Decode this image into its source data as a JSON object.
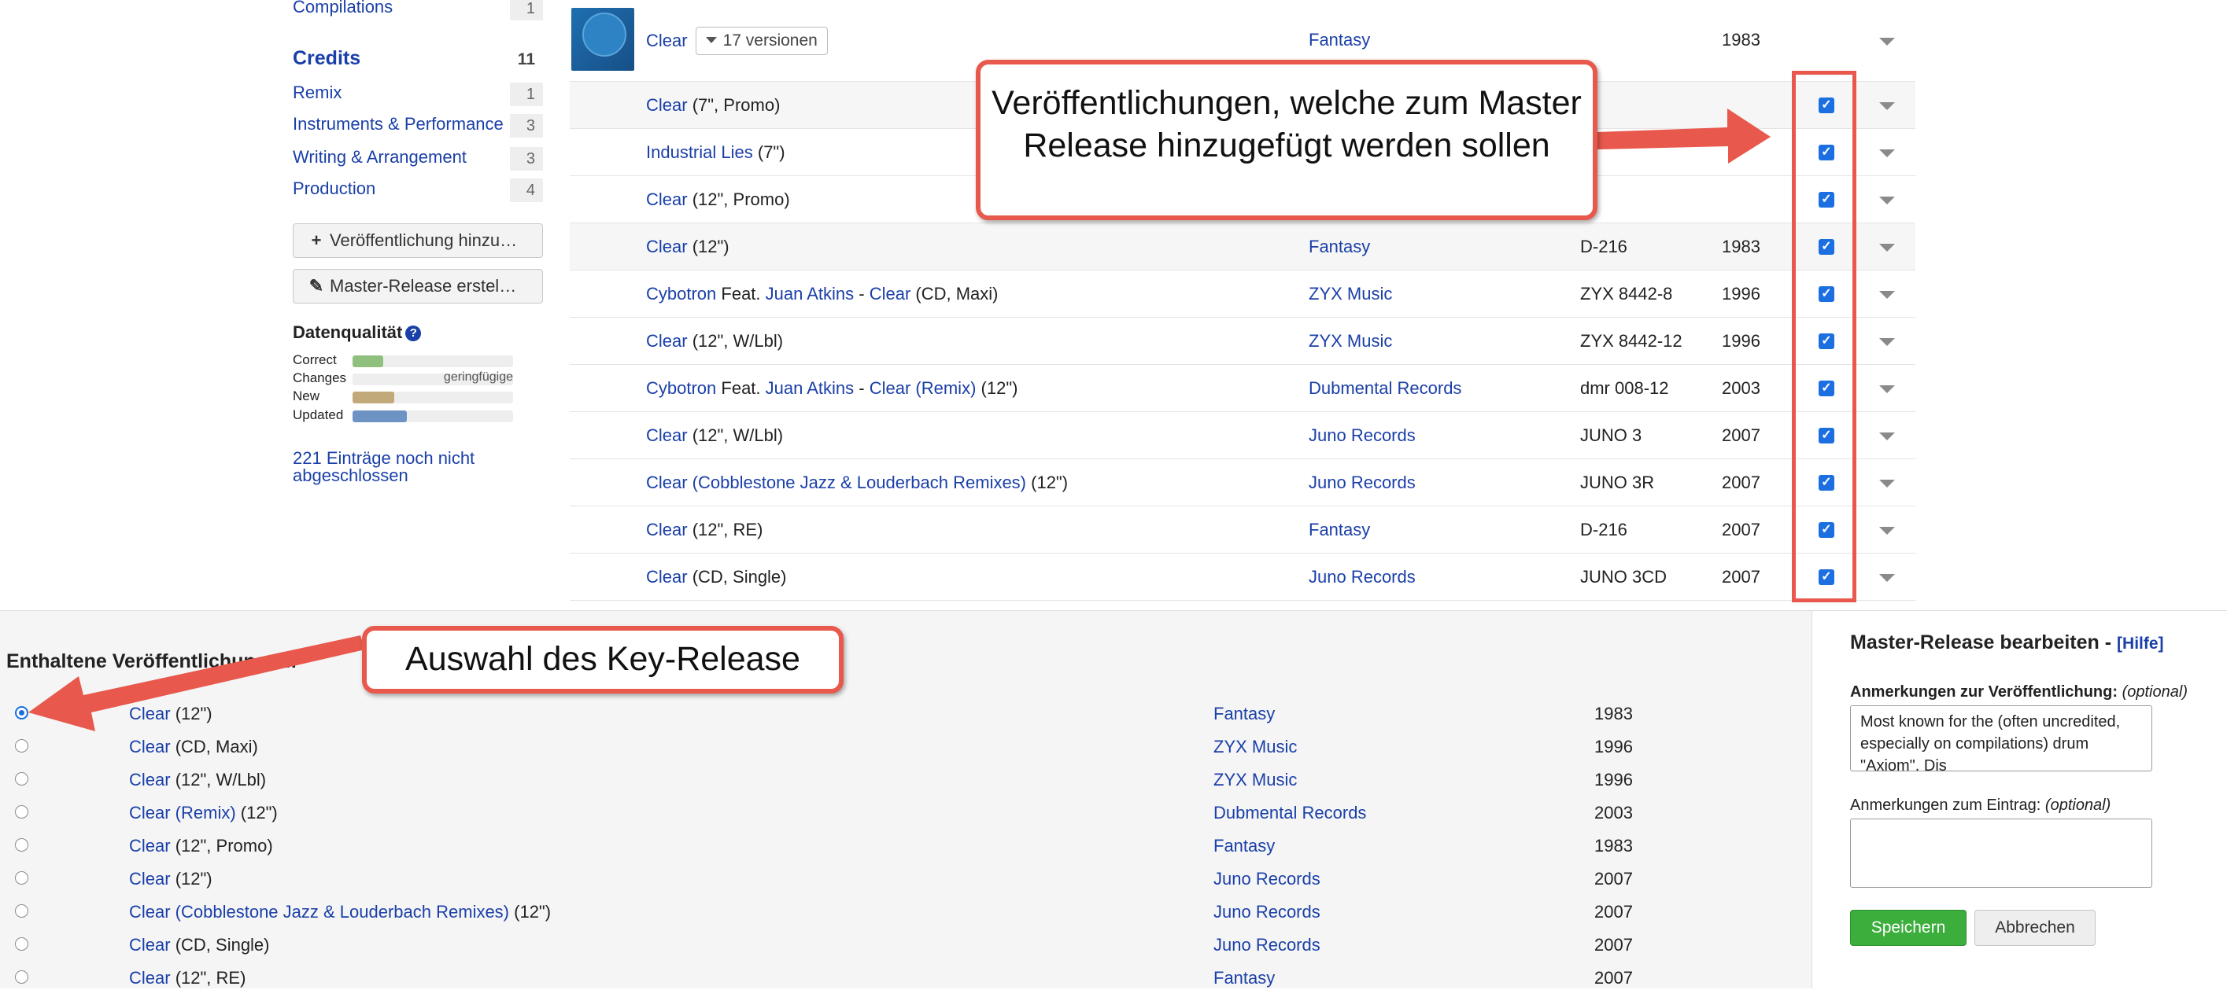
{
  "sidebar": {
    "compilations": {
      "label": "Compilations",
      "count": "1"
    },
    "credits": {
      "heading": "Credits",
      "count": "11"
    },
    "credit_items": [
      {
        "label": "Remix",
        "count": "1"
      },
      {
        "label": "Instruments & Performance",
        "count": "3"
      },
      {
        "label": "Writing & Arrangement",
        "count": "3"
      },
      {
        "label": "Production",
        "count": "4"
      }
    ],
    "buttons": {
      "add_release": "Veröffentlichung hinzu…",
      "create_master": "Master-Release erstel…"
    },
    "data_quality": {
      "title": "Datenqualität",
      "rows": [
        {
          "name": "Correct",
          "value": 0.19,
          "color": "#8fc07e",
          "note": ""
        },
        {
          "name": "Changes",
          "value": 0.0,
          "color": "#c9c9c9",
          "note": "geringfügige"
        },
        {
          "name": "New",
          "value": 0.26,
          "color": "#c2a97a",
          "note": ""
        },
        {
          "name": "Updated",
          "value": 0.34,
          "color": "#6d93c5",
          "note": ""
        }
      ]
    },
    "pending_link": "221 Einträge noch nicht abgeschlossen"
  },
  "master": {
    "title": "Clear",
    "versions_button": "17 versionen",
    "label": "Fantasy",
    "year": "1983"
  },
  "versions": [
    {
      "parts": [
        {
          "t": "Clear",
          "link": true
        },
        {
          "t": " (7\", Promo)",
          "link": false
        }
      ],
      "label": "",
      "cat": "",
      "year": "",
      "alt": true
    },
    {
      "parts": [
        {
          "t": "Industrial Lies",
          "link": true
        },
        {
          "t": " (7\")",
          "link": false
        }
      ],
      "label": "",
      "cat": "",
      "year": "",
      "alt": false
    },
    {
      "parts": [
        {
          "t": "Clear",
          "link": true
        },
        {
          "t": " (12\", Promo)",
          "link": false
        }
      ],
      "label": "",
      "cat": "",
      "year": "",
      "alt": false
    },
    {
      "parts": [
        {
          "t": "Clear",
          "link": true
        },
        {
          "t": " (12\")",
          "link": false
        }
      ],
      "label": "Fantasy",
      "cat": "D-216",
      "year": "1983",
      "alt": true
    },
    {
      "parts": [
        {
          "t": "Cybotron",
          "link": true
        },
        {
          "t": " Feat. ",
          "link": false
        },
        {
          "t": "Juan Atkins",
          "link": true
        },
        {
          "t": " - ",
          "link": false
        },
        {
          "t": "Clear",
          "link": true
        },
        {
          "t": " (CD, Maxi)",
          "link": false
        }
      ],
      "label": "ZYX Music",
      "cat": "ZYX 8442-8",
      "year": "1996",
      "alt": false
    },
    {
      "parts": [
        {
          "t": "Clear",
          "link": true
        },
        {
          "t": " (12\", W/Lbl)",
          "link": false
        }
      ],
      "label": "ZYX Music",
      "cat": "ZYX 8442-12",
      "year": "1996",
      "alt": false
    },
    {
      "parts": [
        {
          "t": "Cybotron",
          "link": true
        },
        {
          "t": " Feat. ",
          "link": false
        },
        {
          "t": "Juan Atkins",
          "link": true
        },
        {
          "t": " - ",
          "link": false
        },
        {
          "t": "Clear (Remix)",
          "link": true
        },
        {
          "t": " (12\")",
          "link": false
        }
      ],
      "label": "Dubmental Records",
      "cat": "dmr 008-12",
      "year": "2003",
      "alt": false
    },
    {
      "parts": [
        {
          "t": "Clear",
          "link": true
        },
        {
          "t": " (12\", W/Lbl)",
          "link": false
        }
      ],
      "label": "Juno Records",
      "cat": "JUNO 3",
      "year": "2007",
      "alt": false
    },
    {
      "parts": [
        {
          "t": "Clear (Cobblestone Jazz & Louderbach Remixes)",
          "link": true
        },
        {
          "t": " (12\")",
          "link": false
        }
      ],
      "label": "Juno Records",
      "cat": "JUNO 3R",
      "year": "2007",
      "alt": false
    },
    {
      "parts": [
        {
          "t": "Clear",
          "link": true
        },
        {
          "t": " (12\", RE)",
          "link": false
        }
      ],
      "label": "Fantasy",
      "cat": "D-216",
      "year": "2007",
      "alt": false
    },
    {
      "parts": [
        {
          "t": "Clear",
          "link": true
        },
        {
          "t": " (CD, Single)",
          "link": false
        }
      ],
      "label": "Juno Records",
      "cat": "JUNO 3CD",
      "year": "2007",
      "alt": false
    }
  ],
  "included": {
    "title": "Enthaltene Veröffentlichungen:",
    "rows": [
      {
        "link": "Clear",
        "rest": " (12\")",
        "label": "Fantasy",
        "year": "1983",
        "selected": true
      },
      {
        "link": "Clear",
        "rest": " (CD, Maxi)",
        "label": "ZYX Music",
        "year": "1996",
        "selected": false
      },
      {
        "link": "Clear",
        "rest": " (12\", W/Lbl)",
        "label": "ZYX Music",
        "year": "1996",
        "selected": false
      },
      {
        "link": "Clear (Remix)",
        "rest": " (12\")",
        "label": "Dubmental Records",
        "year": "2003",
        "selected": false
      },
      {
        "link": "Clear",
        "rest": " (12\", Promo)",
        "label": "Fantasy",
        "year": "1983",
        "selected": false
      },
      {
        "link": "Clear",
        "rest": " (12\")",
        "label": "Juno Records",
        "year": "2007",
        "selected": false
      },
      {
        "link": "Clear (Cobblestone Jazz & Louderbach Remixes)",
        "rest": " (12\")",
        "label": "Juno Records",
        "year": "2007",
        "selected": false
      },
      {
        "link": "Clear",
        "rest": " (CD, Single)",
        "label": "Juno Records",
        "year": "2007",
        "selected": false
      },
      {
        "link": "Clear",
        "rest": " (12\", RE)",
        "label": "Fantasy",
        "year": "2007",
        "selected": false
      }
    ]
  },
  "edit_panel": {
    "title": "Master-Release bearbeiten",
    "dash": " - ",
    "help": "[Hilfe]",
    "notes_release_label": "Anmerkungen zur Veröffentlichung:",
    "notes_release_optional": "(optional)",
    "notes_release_value": "Most known for the (often uncredited, especially on compilations) drum \"Axiom\". Dis",
    "notes_entry_label": "Anmerkungen zum Eintrag:",
    "notes_entry_optional": "(optional)",
    "notes_entry_value": "",
    "save": "Speichern",
    "cancel": "Abbrechen"
  },
  "annotations": {
    "top": "Veröffentlichungen, welche zum Master Release hinzugefügt werden sollen",
    "bottom": "Auswahl des Key-Release",
    "color": "#e8584c"
  },
  "colors": {
    "link": "#1a3fa8",
    "checkbox": "#1b6fe0",
    "save": "#3cae3c"
  }
}
